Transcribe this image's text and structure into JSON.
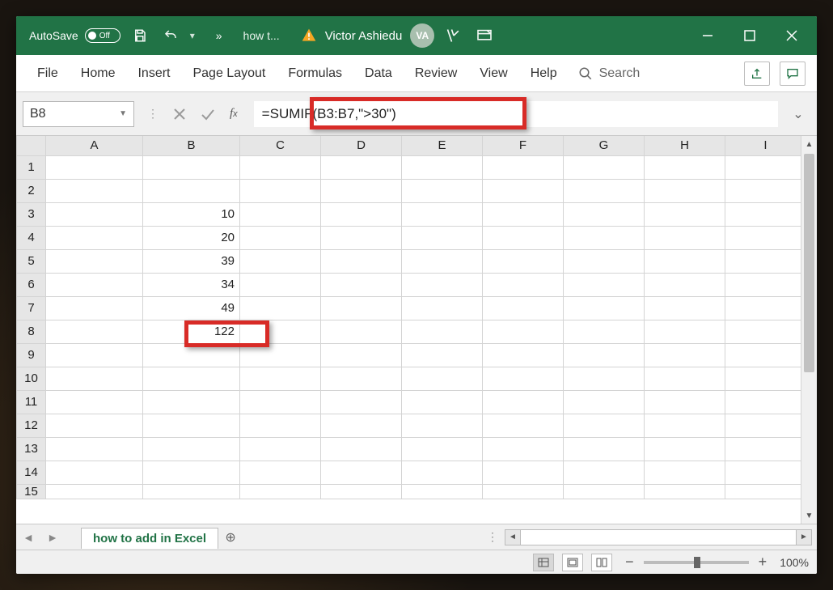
{
  "titlebar": {
    "autosave_label": "AutoSave",
    "autosave_state": "Off",
    "file_title": "how t...",
    "user_name": "Victor Ashiedu",
    "user_initials": "VA"
  },
  "ribbon": {
    "tabs": [
      "File",
      "Home",
      "Insert",
      "Page Layout",
      "Formulas",
      "Data",
      "Review",
      "View",
      "Help"
    ],
    "search_label": "Search"
  },
  "formula_bar": {
    "name_box": "B8",
    "formula": "=SUMIF(B3:B7,\">30\")"
  },
  "grid": {
    "columns": [
      "A",
      "B",
      "C",
      "D",
      "E",
      "F",
      "G",
      "H",
      "I"
    ],
    "rows": [
      "1",
      "2",
      "3",
      "4",
      "5",
      "6",
      "7",
      "8",
      "9",
      "10",
      "11",
      "12",
      "13",
      "14",
      "15"
    ],
    "cells": {
      "B3": "10",
      "B4": "20",
      "B5": "39",
      "B6": "34",
      "B7": "49",
      "B8": "122"
    },
    "result_cell": "B8"
  },
  "tabs": {
    "sheet_name": "how to add in Excel"
  },
  "status": {
    "zoom": "100%"
  }
}
